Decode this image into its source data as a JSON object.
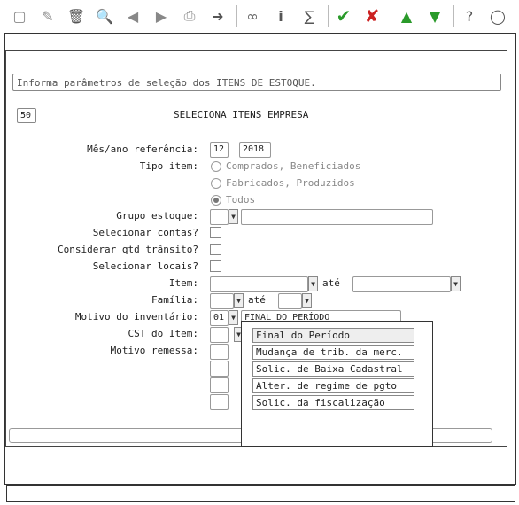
{
  "toolbar": {
    "icons": [
      "new-icon",
      "edit-icon",
      "delete-icon",
      "search-icon",
      "prev-icon",
      "next-icon",
      "print-icon",
      "export-icon",
      "binoculars-icon",
      "info-icon",
      "sum-icon",
      "confirm-icon",
      "cancel-icon",
      "up-icon",
      "down-icon",
      "help-icon",
      "chat-icon"
    ]
  },
  "info_text": "Informa parâmetros de seleção dos ITENS DE ESTOQUE.",
  "program_code": "50",
  "title": "SELECIONA ITENS EMPRESA",
  "labels": {
    "mes_ano": "Mês/ano referência:",
    "tipo_item": "Tipo item:",
    "grupo_estoque": "Grupo estoque:",
    "sel_contas": "Selecionar contas?",
    "qtd_transito": "Considerar qtd trânsito?",
    "sel_locais": "Selecionar locais?",
    "item": "Item:",
    "familia": "Família:",
    "motivo_inv": "Motivo do inventário:",
    "cst": "CST do Item:",
    "motivo_remessa": "Motivo remessa:",
    "ate": "até"
  },
  "values": {
    "mes": "12",
    "ano": "2018",
    "motivo_codigo": "01",
    "motivo_desc": "FINAL DO PERÍODO"
  },
  "tipo_options": [
    "Comprados, Beneficiados",
    "Fabricados, Produzidos",
    "Todos"
  ],
  "tipo_selected": "Todos",
  "dropdown_options": [
    "Final do Período",
    "Mudança de trib. da merc.",
    "Solic. de Baixa Cadastral",
    "Alter. de regime de pgto",
    "Solic. da fiscalização"
  ]
}
